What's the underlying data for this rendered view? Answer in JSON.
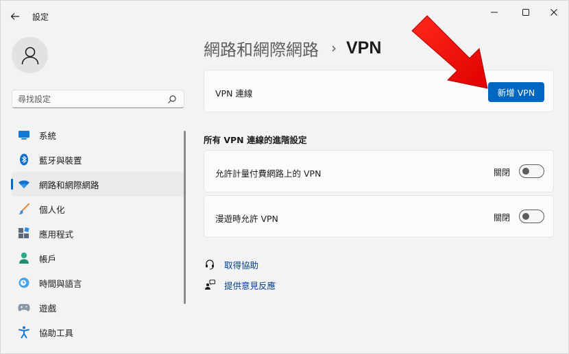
{
  "window": {
    "title": "設定"
  },
  "search": {
    "placeholder": "尋找設定"
  },
  "sidebar": {
    "items": [
      {
        "label": "系統",
        "icon": "system-icon"
      },
      {
        "label": "藍牙與裝置",
        "icon": "bluetooth-icon"
      },
      {
        "label": "網路和網際網路",
        "icon": "wifi-icon",
        "active": true
      },
      {
        "label": "個人化",
        "icon": "brush-icon"
      },
      {
        "label": "應用程式",
        "icon": "apps-icon"
      },
      {
        "label": "帳戶",
        "icon": "account-icon"
      },
      {
        "label": "時間與語言",
        "icon": "time-language-icon"
      },
      {
        "label": "遊戲",
        "icon": "gamepad-icon"
      },
      {
        "label": "協助工具",
        "icon": "accessibility-icon"
      }
    ]
  },
  "breadcrumb": {
    "parent": "網路和網際網路",
    "separator": "›",
    "current": "VPN"
  },
  "vpn_card": {
    "label": "VPN 連線",
    "add_button": "新增 VPN"
  },
  "advanced": {
    "title": "所有 VPN 連線的進階設定",
    "metered": {
      "label": "允許計量付費網路上的 VPN",
      "state": "關閉",
      "on": false
    },
    "roaming": {
      "label": "漫遊時允許 VPN",
      "state": "關閉",
      "on": false
    }
  },
  "links": {
    "help": "取得協助",
    "feedback": "提供意見反應"
  },
  "colors": {
    "accent": "#0067c0",
    "annotation": "#ff0000",
    "link": "#003e92"
  }
}
